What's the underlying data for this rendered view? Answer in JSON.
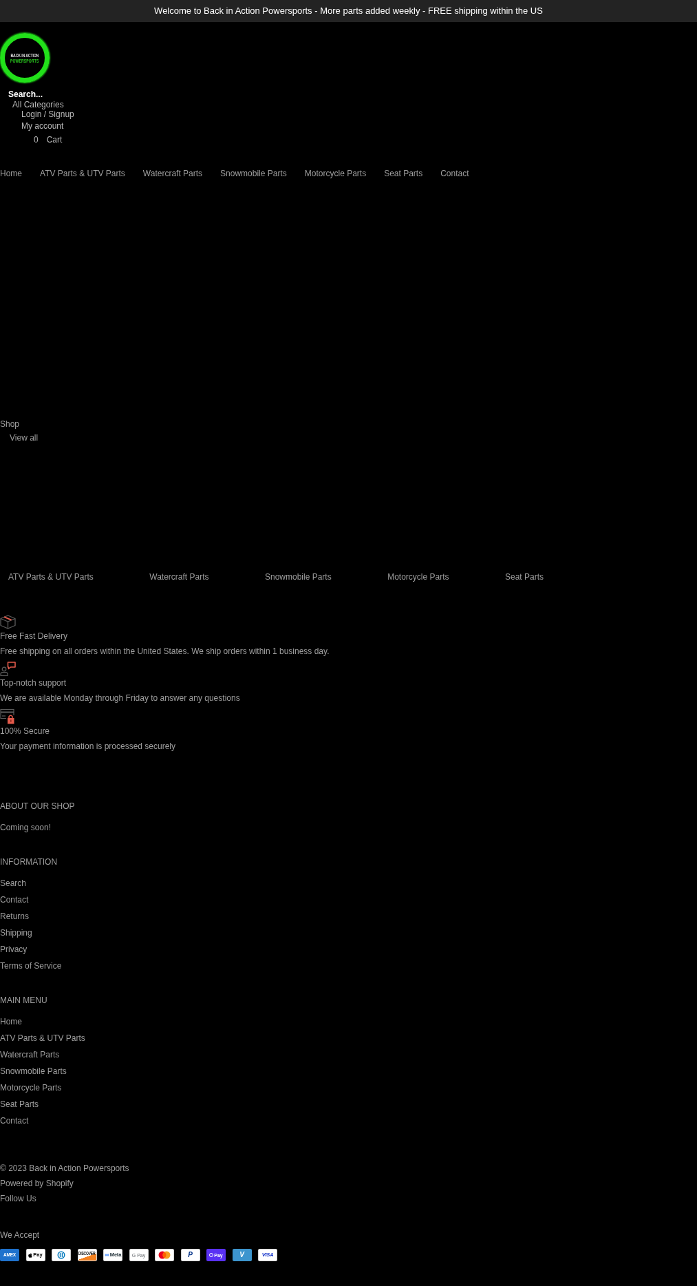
{
  "announcement": {
    "text": "Welcome to Back in Action Powersports - More parts added weekly - FREE shipping within the US"
  },
  "header": {
    "logo": {
      "lines": [
        "BACK IN ACTION",
        "POWERSPORTS"
      ]
    },
    "search": {
      "placeholder": "Search..."
    },
    "category_select": {
      "value": "All Categories"
    },
    "account": {
      "login": "Login / Signup",
      "my_account": "My account"
    },
    "cart": {
      "count": "0",
      "label": "Cart"
    }
  },
  "nav": [
    {
      "label": "Home"
    },
    {
      "label": "ATV Parts & UTV Parts"
    },
    {
      "label": "Watercraft Parts"
    },
    {
      "label": "Snowmobile Parts"
    },
    {
      "label": "Motorcycle Parts"
    },
    {
      "label": "Seat Parts"
    },
    {
      "label": "Contact"
    }
  ],
  "shop": {
    "title": "Shop",
    "view_all": "View all",
    "collections": [
      {
        "label": "ATV Parts & UTV Parts"
      },
      {
        "label": "Watercraft Parts"
      },
      {
        "label": "Snowmobile Parts"
      },
      {
        "label": "Motorcycle Parts"
      },
      {
        "label": "Seat Parts"
      }
    ]
  },
  "features": [
    {
      "kind": "delivery",
      "title": "Free Fast Delivery",
      "text": "Free shipping on all orders within the United States. We ship orders within 1 business day."
    },
    {
      "kind": "support",
      "title": "Top-notch support",
      "text": "We are available Monday through Friday to answer any questions"
    },
    {
      "kind": "secure",
      "title": "100% Secure",
      "text": "Your payment information is processed securely"
    }
  ],
  "footer": {
    "sections": [
      {
        "title": "ABOUT OUR SHOP",
        "text": "Coming soon!"
      },
      {
        "title": "INFORMATION",
        "links": [
          "Search",
          "Contact",
          "Returns",
          "Shipping",
          "Privacy",
          "Terms of Service"
        ]
      },
      {
        "title": "MAIN MENU",
        "links": [
          "Home",
          "ATV Parts & UTV Parts",
          "Watercraft Parts",
          "Snowmobile Parts",
          "Motorcycle Parts",
          "Seat Parts",
          "Contact"
        ]
      }
    ],
    "copyright": "© 2023 Back in Action Powersports",
    "powered_by": "Powered by Shopify",
    "follow_us": "Follow Us",
    "payments": {
      "title": "We Accept",
      "methods": [
        {
          "kind": "amex",
          "label": "AMEX"
        },
        {
          "kind": "apple_pay",
          "label": "Pay"
        },
        {
          "kind": "diners"
        },
        {
          "kind": "discover",
          "label": "DISCOVER"
        },
        {
          "kind": "meta_pay",
          "label": "Meta"
        },
        {
          "kind": "google_pay",
          "label": "G Pay"
        },
        {
          "kind": "mastercard"
        },
        {
          "kind": "paypal",
          "label": "P"
        },
        {
          "kind": "shop_pay",
          "label": "Pay"
        },
        {
          "kind": "venmo",
          "label": "V"
        },
        {
          "kind": "visa",
          "label": "VISA"
        }
      ]
    }
  }
}
